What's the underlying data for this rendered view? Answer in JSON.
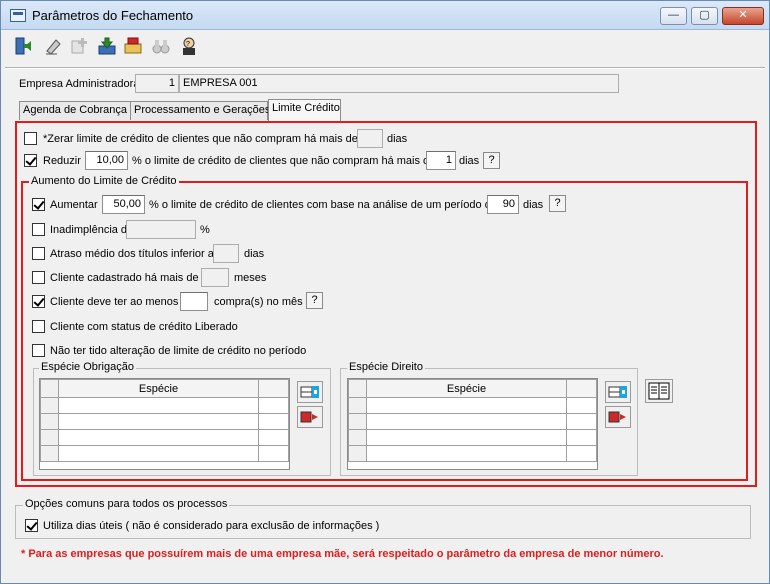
{
  "window": {
    "title": "Parâmetros do Fechamento",
    "min_glyph": "—",
    "max_glyph": "▢",
    "close_glyph": "✕"
  },
  "toolbar": {
    "items": [
      "exit-icon",
      "eraser-icon",
      "add-icon",
      "save-icon",
      "open-folder-icon",
      "binoculars-icon",
      "user-help-icon"
    ]
  },
  "empresa": {
    "label": "Empresa Administradora",
    "code": "1",
    "name": "EMPRESA 001"
  },
  "tabs": [
    {
      "label": "Agenda de Cobrança"
    },
    {
      "label": "Processamento e Gerações"
    },
    {
      "label": "Limite Crédito",
      "active": true
    }
  ],
  "limite": {
    "zerar": {
      "label": "*Zerar limite de crédito de clientes que não compram há mais de",
      "value": "",
      "unit": "dias",
      "checked": false
    },
    "reduzir": {
      "label": "Reduzir",
      "percent": "10,00",
      "text": "% o limite de crédito de clientes que não compram há mais de",
      "value": "1",
      "unit": "dias",
      "checked": true,
      "help": "?"
    }
  },
  "aumento": {
    "title": "Aumento do Limite de Crédito",
    "aumentar": {
      "label": "Aumentar",
      "percent": "50,00",
      "text": "% o limite de crédito de clientes com base na análise de um período de",
      "value": "90",
      "unit": "dias",
      "checked": true,
      "help": "?"
    },
    "inadimplencia": {
      "label": "Inadimplência de até",
      "value": "",
      "unit": "%",
      "checked": false
    },
    "atraso": {
      "label": "Atraso médio dos títulos inferior a",
      "value": "",
      "unit": "dias",
      "checked": false
    },
    "cadastrado": {
      "label": "Cliente cadastrado há mais de",
      "value": "",
      "unit": "meses",
      "checked": false
    },
    "compras": {
      "label": "Cliente deve ter ao menos",
      "value": "",
      "unit": "compra(s) no mês",
      "checked": true,
      "help": "?"
    },
    "status": {
      "label": "Cliente com status de crédito Liberado",
      "checked": false
    },
    "nao_alteracao": {
      "label": "Não ter tido alteração de limite de crédito no período",
      "checked": false
    },
    "obrigacao": {
      "title": "Espécie Obrigação",
      "column": "Espécie"
    },
    "direito": {
      "title": "Espécie Direito",
      "column": "Espécie"
    }
  },
  "comuns": {
    "title": "Opções comuns para todos os processos",
    "dias_uteis": {
      "label": "Utiliza dias úteis ( não é considerado para exclusão de informações )",
      "checked": true
    }
  },
  "footer_note": "* Para as empresas que possuírem mais de uma empresa mãe, será respeitado o parâmetro da empresa de menor número.",
  "colors": {
    "accent_red": "#e01c1c"
  }
}
